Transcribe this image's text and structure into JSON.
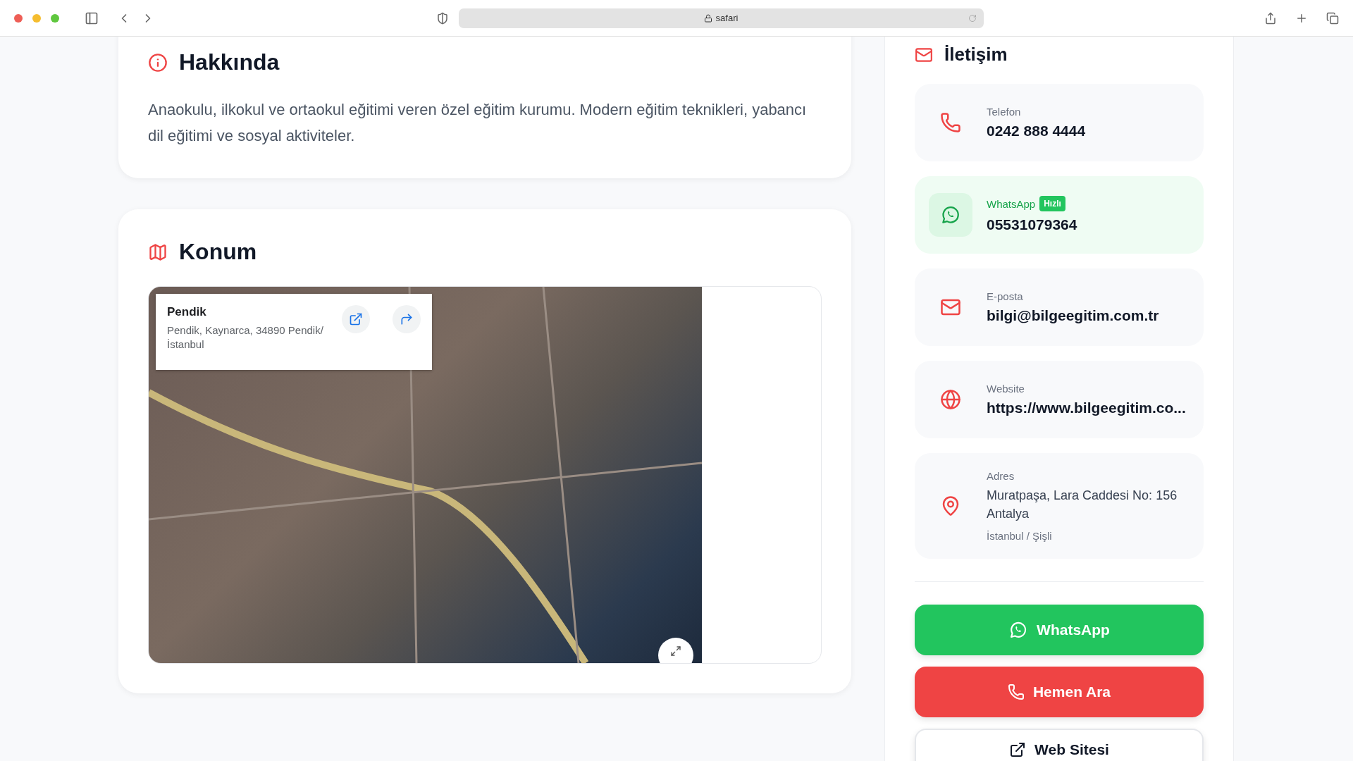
{
  "browser": {
    "address": "safari"
  },
  "about": {
    "title": "Hakkında",
    "text": "Anaokulu, ilkokul ve ortaokul eğitimi veren özel eğitim kurumu. Modern eğitim teknikleri, yabancı dil eğitimi ve sosyal aktiviteler."
  },
  "location": {
    "title": "Konum",
    "map_card": {
      "name": "Pendik",
      "address": "Pendik, Kaynarca, 34890 Pendik/ İstanbul"
    }
  },
  "contact": {
    "title": "İletişim",
    "items": [
      {
        "kind": "phone",
        "label": "Telefon",
        "value": "0242 888 4444",
        "highlighted": false
      },
      {
        "kind": "whatsapp",
        "label": "WhatsApp",
        "badge": "Hızlı",
        "value": "05531079364",
        "highlighted": true
      },
      {
        "kind": "email",
        "label": "E-posta",
        "value": "bilgi@bilgeegitim.com.tr",
        "highlighted": false
      },
      {
        "kind": "website",
        "label": "Website",
        "value": "https://www.bilgeegitim.co...",
        "highlighted": false
      },
      {
        "kind": "address",
        "label": "Adres",
        "value": "Muratpaşa, Lara Caddesi No: 156 Antalya",
        "sub": "İstanbul / Şişli",
        "highlighted": false
      }
    ],
    "buttons": [
      {
        "kind": "whatsapp",
        "label": "WhatsApp"
      },
      {
        "kind": "call",
        "label": "Hemen Ara"
      },
      {
        "kind": "web",
        "label": "Web Sitesi"
      }
    ]
  }
}
